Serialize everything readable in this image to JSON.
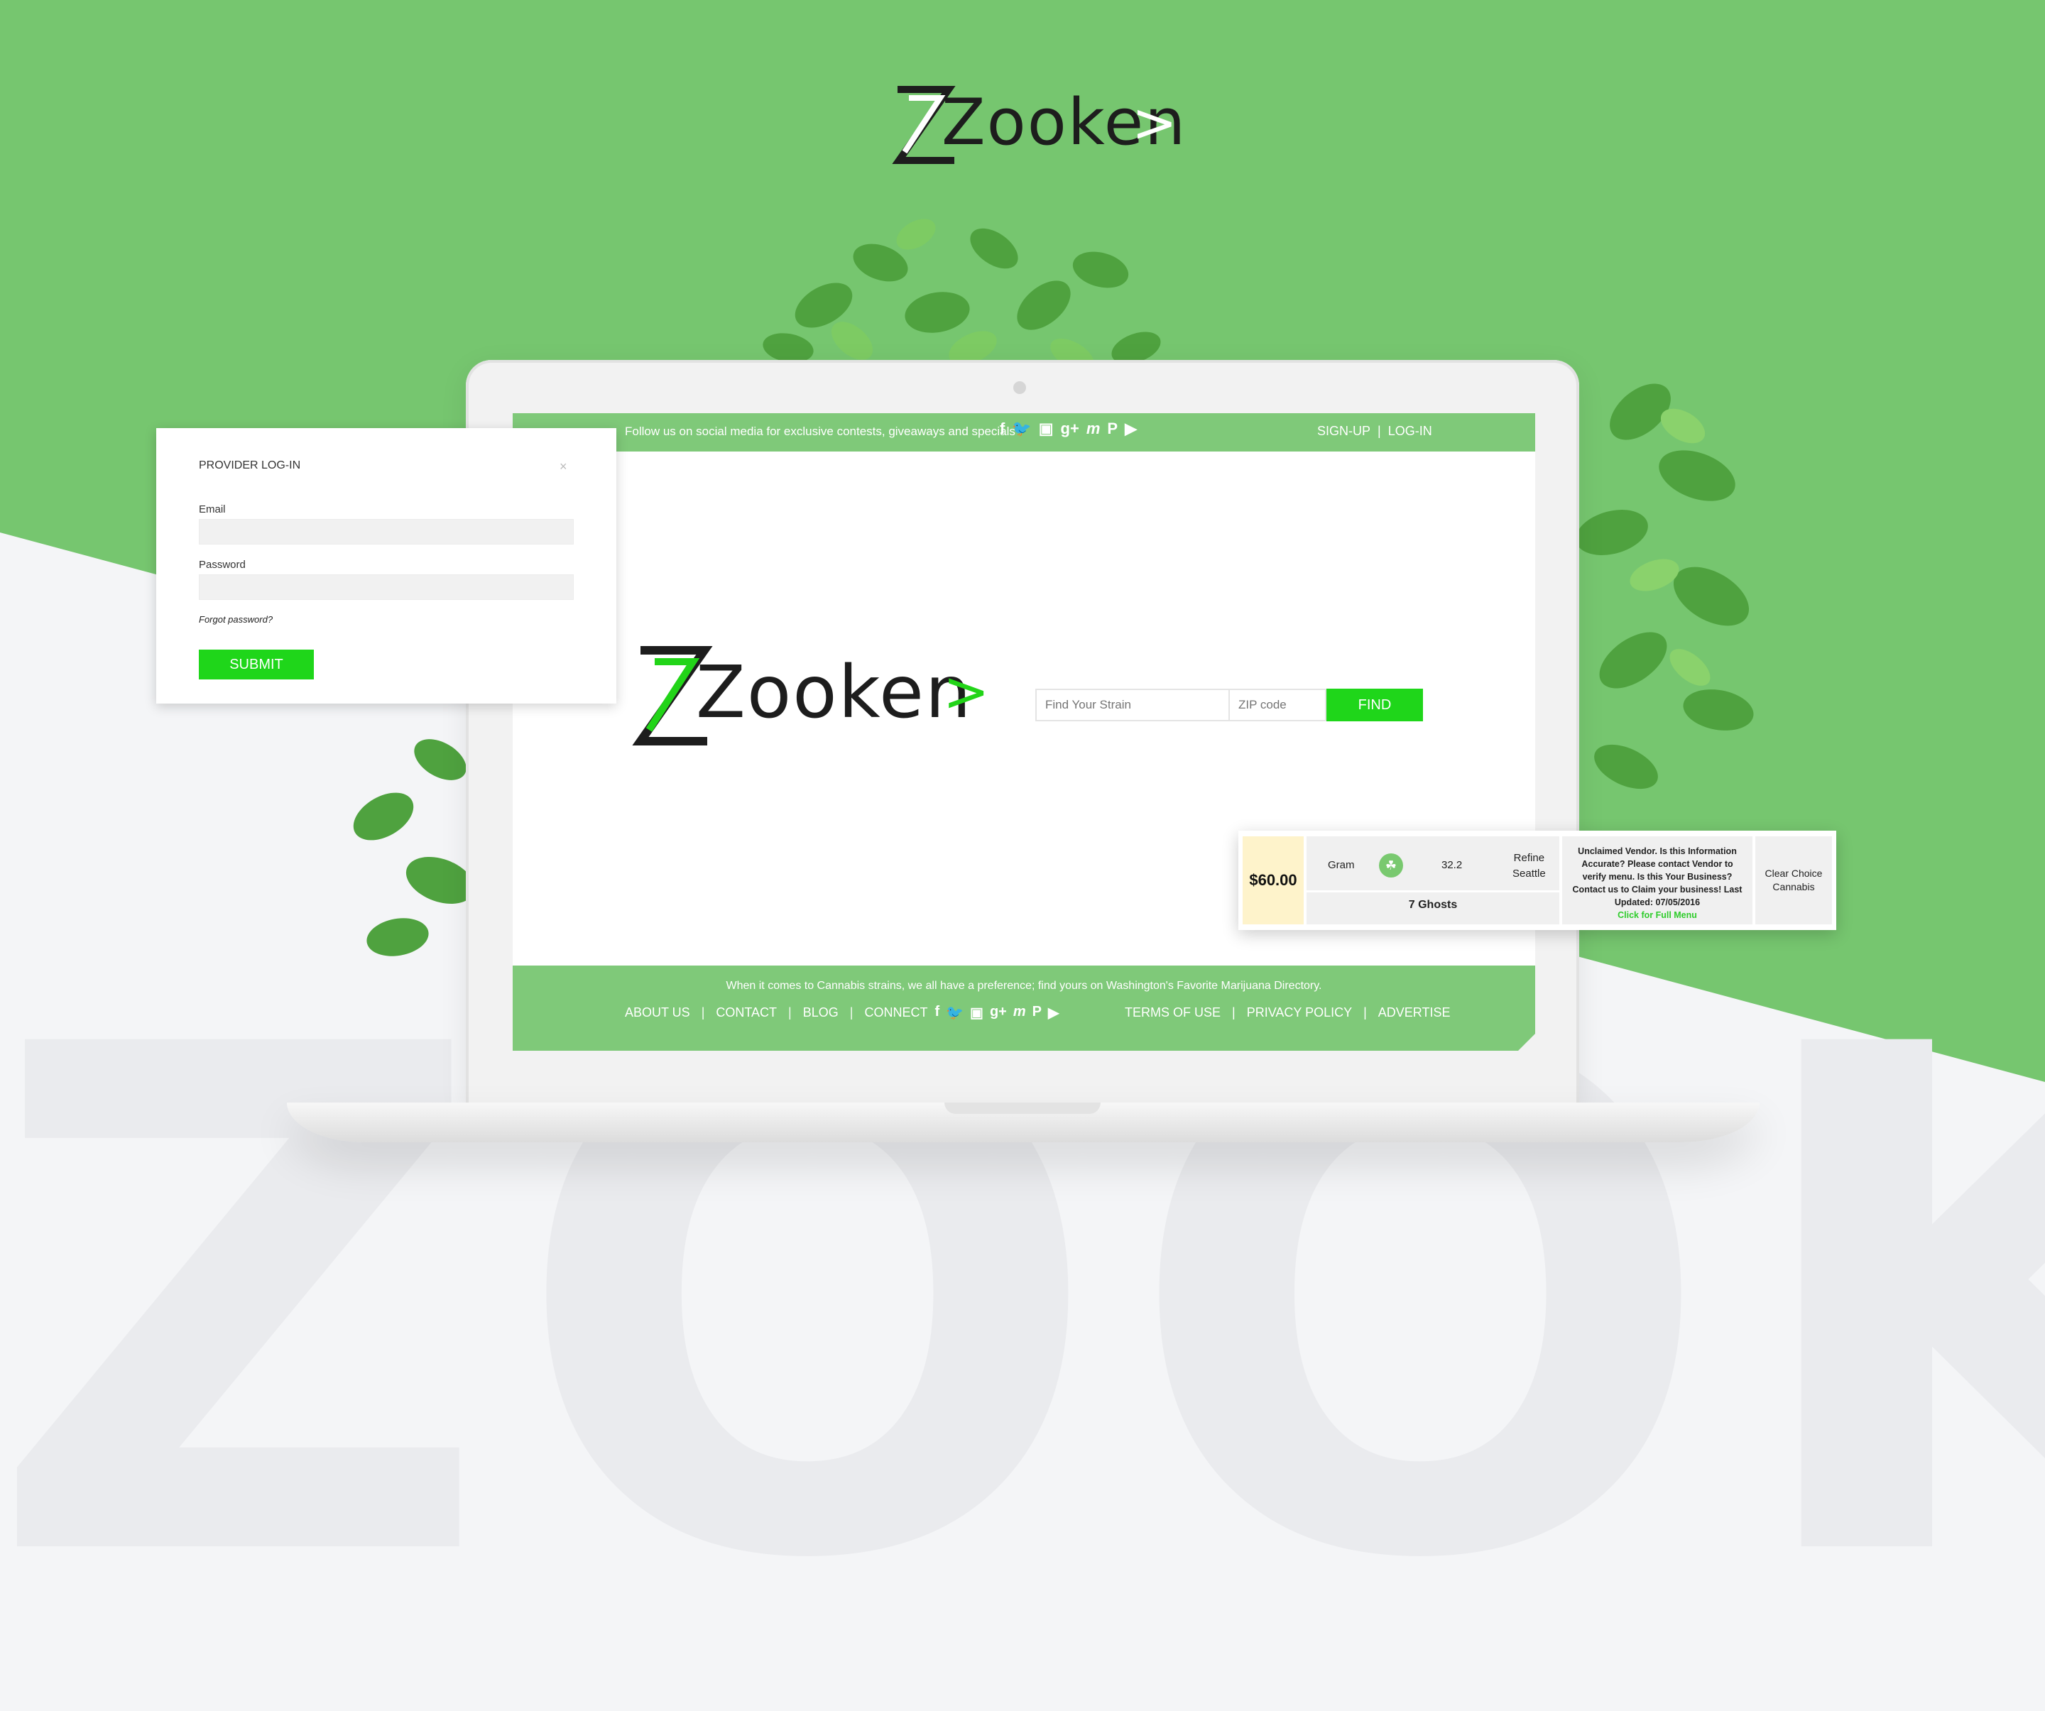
{
  "brand": {
    "logo_text": "Zooken",
    "logo_arrow": ">",
    "watermark": "ZOOKEN"
  },
  "colors": {
    "brand_green": "#7cc76e",
    "button_green": "#1fd61a",
    "price_bg": "#fef3cb"
  },
  "site": {
    "topbar": {
      "follow_text": "Follow us on social media for exclusive contests, giveaways and specials",
      "social_icons": [
        "facebook-icon",
        "twitter-icon",
        "instagram-icon",
        "google-plus-icon",
        "myspace-icon",
        "pinterest-icon",
        "youtube-icon"
      ],
      "signup": "SIGN-UP",
      "divider": "|",
      "login": "LOG-IN"
    },
    "search": {
      "strain_placeholder": "Find Your Strain",
      "zip_placeholder": "ZIP code",
      "find_label": "FIND"
    },
    "footer": {
      "tagline": "When it comes to Cannabis strains, we all have a preference; find yours on Washington's Favorite Marijuana Directory.",
      "about": "ABOUT US",
      "contact": "CONTACT",
      "blog": "BLOG",
      "connect": "CONNECT",
      "terms": "TERMS OF USE",
      "privacy": "PRIVACY POLICY",
      "advertise": "ADVERTISE",
      "sep": "|"
    }
  },
  "login_modal": {
    "title": "PROVIDER LOG-IN",
    "close": "×",
    "email_label": "Email",
    "password_label": "Password",
    "forgot": "Forgot password?",
    "submit": "SUBMIT"
  },
  "price_card": {
    "price": "$60.00",
    "unit": "Gram",
    "value": "32.2",
    "location_line1": "Refine",
    "location_line2": "Seattle",
    "strain": "7 Ghosts",
    "notice": "Unclaimed Vendor. Is this Information Accurate? Please contact Vendor to verify menu. Is this Your Business? Contact us to Claim your business! Last Updated: 07/05/2016",
    "menu_link": "Click for Full Menu",
    "vendor_line1": "Clear Choice",
    "vendor_line2": "Cannabis"
  }
}
